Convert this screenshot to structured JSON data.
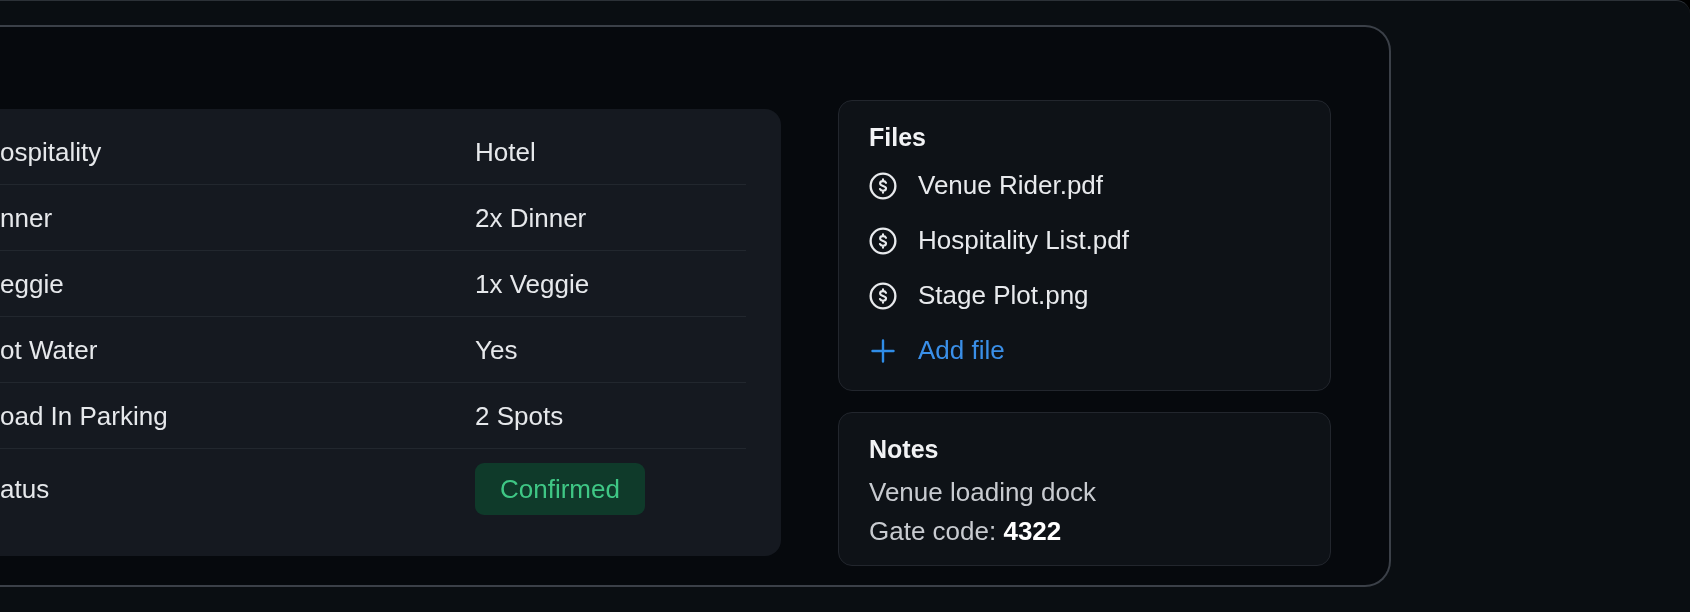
{
  "details": {
    "rows": [
      {
        "label": "ospitality",
        "value": "Hotel",
        "kind": "text"
      },
      {
        "label": "nner",
        "value": "2x Dinner",
        "kind": "text"
      },
      {
        "label": "eggie",
        "value": "1x Veggie",
        "kind": "text"
      },
      {
        "label": "ot Water",
        "value": "Yes",
        "kind": "text"
      },
      {
        "label": "oad In Parking",
        "value": "2 Spots",
        "kind": "text"
      },
      {
        "label": "atus",
        "value": "Confirmed",
        "kind": "badge"
      }
    ]
  },
  "files": {
    "title": "Files",
    "items": [
      {
        "name": "Venue Rider.pdf"
      },
      {
        "name": "Hospitality List.pdf"
      },
      {
        "name": "Stage Plot.png"
      }
    ],
    "add_label": "Add file"
  },
  "notes": {
    "title": "Notes",
    "lines": [
      "Venue loading dock",
      "Gate code: **4322**"
    ]
  }
}
